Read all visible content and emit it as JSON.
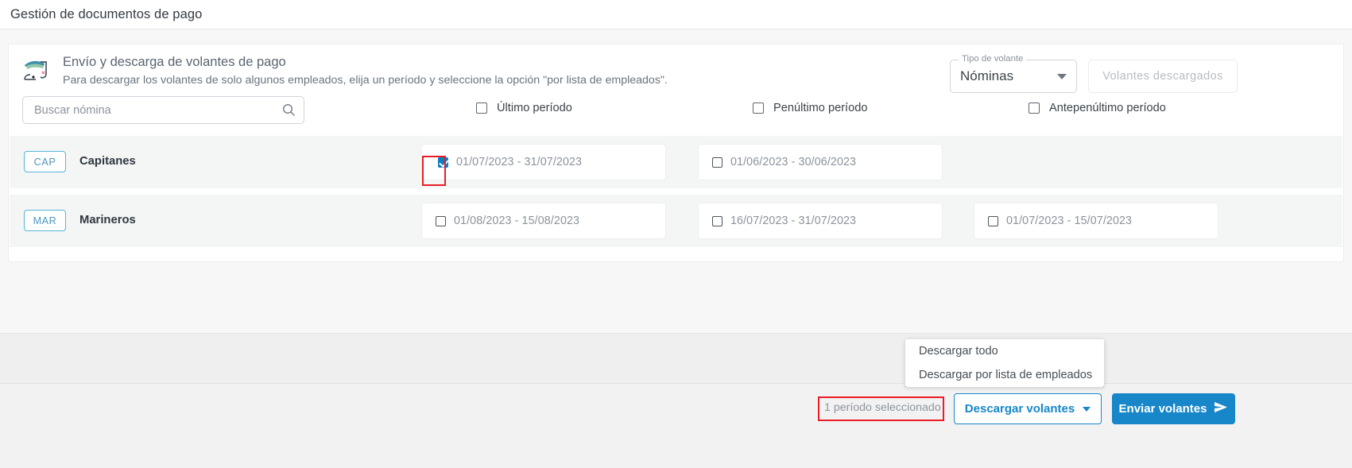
{
  "titlebar": {
    "title": "Gestión de documentos de pago"
  },
  "header": {
    "icon": "payroll-stamp-icon",
    "title": "Envío y descarga de volantes de pago",
    "subtitle": "Para descargar los volantes de solo algunos empleados, elija un período y seleccione la opción \"por lista de empleados\".",
    "volante_type": {
      "legend": "Tipo de volante",
      "value": "Nóminas",
      "caret": "chevron-down-icon"
    },
    "downloaded_button": "Volantes descargados"
  },
  "search": {
    "placeholder": "Buscar nómina",
    "value": "",
    "icon": "search-icon"
  },
  "columns": [
    {
      "label": "Último período",
      "checked": false
    },
    {
      "label": "Penúltimo período",
      "checked": false
    },
    {
      "label": "Antepenúltimo período",
      "checked": false
    }
  ],
  "rows": [
    {
      "code": "CAP",
      "name": "Capitanes",
      "periods": [
        {
          "label": "01/07/2023 - 31/07/2023",
          "checked": true
        },
        {
          "label": "01/06/2023 - 30/06/2023",
          "checked": false
        },
        {
          "label": "",
          "checked": false
        }
      ]
    },
    {
      "code": "MAR",
      "name": "Marineros",
      "periods": [
        {
          "label": "01/08/2023 - 15/08/2023",
          "checked": false
        },
        {
          "label": "16/07/2023 - 31/07/2023",
          "checked": false
        },
        {
          "label": "01/07/2023 - 15/07/2023",
          "checked": false
        }
      ]
    }
  ],
  "menu": {
    "items": [
      {
        "label": "Descargar todo",
        "highlighted": false
      },
      {
        "label": "Descargar por lista de empleados",
        "highlighted": true
      }
    ]
  },
  "footer": {
    "selected_count": "1 período seleccionado",
    "download_button": "Descargar volantes",
    "send_button": "Enviar volantes",
    "send_icon": "send-arrow-icon"
  },
  "colors": {
    "primary": "#1787c9",
    "checkbox_checked": "#0b7dc1",
    "annotation": "#ec1c24",
    "tag_border": "#58b4d8",
    "row_bg": "#f4f6f6"
  }
}
